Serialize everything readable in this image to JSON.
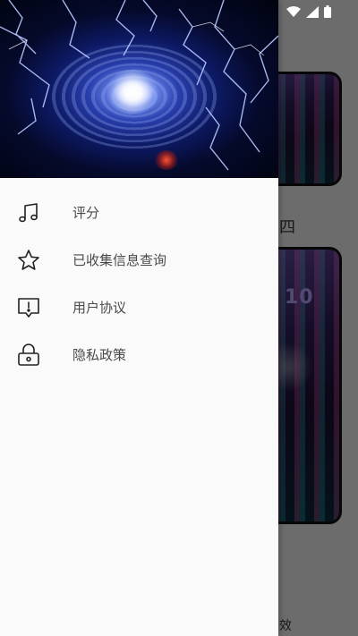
{
  "background": {
    "section_title_char": "四",
    "bottom_text_char": "效",
    "card_clock_text": "10"
  },
  "drawer": {
    "items": [
      {
        "label": "评分",
        "icon": "music-note-icon"
      },
      {
        "label": "已收集信息查询",
        "icon": "star-icon"
      },
      {
        "label": "用户协议",
        "icon": "alert-message-icon"
      },
      {
        "label": "隐私政策",
        "icon": "lock-icon"
      }
    ]
  },
  "colors": {
    "drawer_bg": "#fafafa",
    "icon": "#222222",
    "label": "#4a4a4a"
  }
}
